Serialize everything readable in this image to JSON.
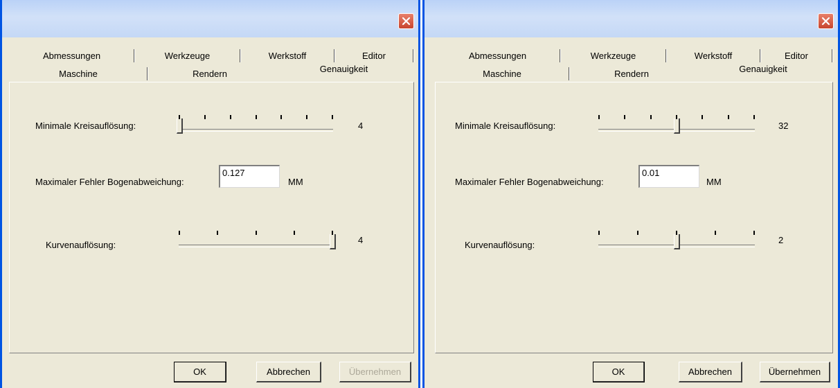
{
  "tabs": {
    "row1": [
      "Abmessungen",
      "Werkzeuge",
      "Werkstoff",
      "Editor"
    ],
    "row2": [
      "Maschine",
      "Rendern",
      "Genauigkeit"
    ]
  },
  "dialogs": [
    {
      "kreis": {
        "label": "Minimale Kreisauflösung:",
        "value": "4",
        "level": 0
      },
      "fehler": {
        "label": "Maximaler Fehler Bogenabweichung:",
        "value": "0.127",
        "unit": "MM"
      },
      "kurve": {
        "label": "Kurvenauflösung:",
        "value": "4",
        "level": 1
      },
      "buttons": {
        "ok": "OK",
        "cancel": "Abbrechen",
        "apply": "Übernehmen",
        "apply_enabled": false
      }
    },
    {
      "kreis": {
        "label": "Minimale Kreisauflösung:",
        "value": "32",
        "level": 0.5
      },
      "fehler": {
        "label": "Maximaler Fehler Bogenabweichung:",
        "value": "0.01",
        "unit": "MM"
      },
      "kurve": {
        "label": "Kurvenauflösung:",
        "value": "2",
        "level": 0.5
      },
      "buttons": {
        "ok": "OK",
        "cancel": "Abbrechen",
        "apply": "Übernehmen",
        "apply_enabled": true
      }
    }
  ],
  "colors": {
    "window_border": "#0054e3",
    "dialog_bg": "#ece9d8",
    "close_button": "#c8452e",
    "disabled_text": "#aca899"
  },
  "icons": {
    "close": "close-icon"
  }
}
